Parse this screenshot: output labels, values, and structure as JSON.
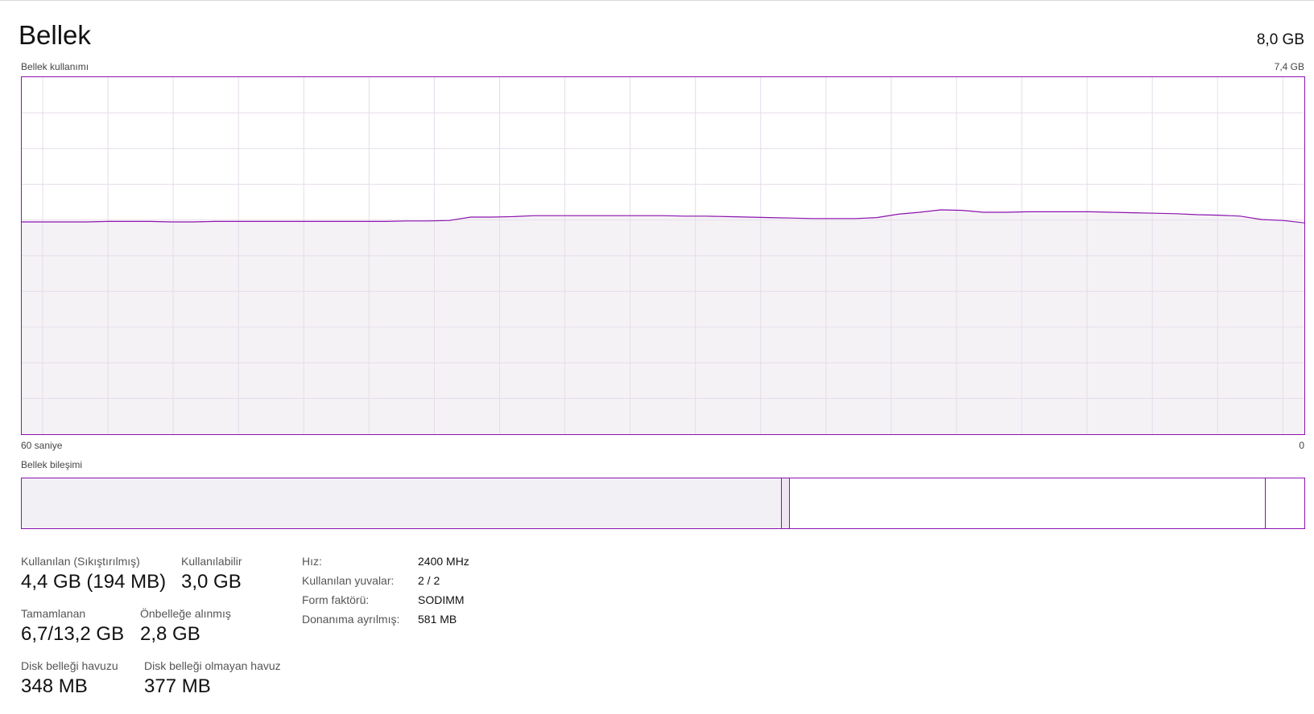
{
  "header": {
    "title": "Bellek",
    "capacity": "8,0 GB"
  },
  "graph": {
    "label": "Bellek kullanımı",
    "max_label": "7,4 GB",
    "time_left_label": "60 saniye",
    "time_right_label": "0",
    "line_color": "#8b12ae",
    "fill_color": "#f3f0f5",
    "grid_color": "#e6dcea",
    "chart_data": {
      "type": "area",
      "x_label": "60 saniye → 0",
      "ylim": [
        0,
        7.4
      ],
      "x": [
        60,
        59,
        58,
        57,
        56,
        55,
        54,
        53,
        52,
        51,
        50,
        49,
        48,
        47,
        46,
        45,
        44,
        43,
        42,
        41,
        40,
        39,
        38,
        37,
        36,
        35,
        34,
        33,
        32,
        31,
        30,
        29,
        28,
        27,
        26,
        25,
        24,
        23,
        22,
        21,
        20,
        19,
        18,
        17,
        16,
        15,
        14,
        13,
        12,
        11,
        10,
        9,
        8,
        7,
        6,
        5,
        4,
        3,
        2,
        1,
        0
      ],
      "values": [
        4.4,
        4.4,
        4.4,
        4.4,
        4.41,
        4.41,
        4.41,
        4.4,
        4.4,
        4.41,
        4.41,
        4.41,
        4.41,
        4.41,
        4.41,
        4.41,
        4.41,
        4.41,
        4.42,
        4.42,
        4.43,
        4.5,
        4.5,
        4.51,
        4.53,
        4.53,
        4.53,
        4.53,
        4.53,
        4.53,
        4.53,
        4.52,
        4.52,
        4.51,
        4.5,
        4.49,
        4.48,
        4.47,
        4.47,
        4.47,
        4.49,
        4.56,
        4.6,
        4.65,
        4.64,
        4.6,
        4.6,
        4.61,
        4.61,
        4.61,
        4.61,
        4.6,
        4.59,
        4.58,
        4.57,
        4.55,
        4.54,
        4.52,
        4.45,
        4.43,
        4.38
      ]
    },
    "vertical_gridlines": 20,
    "horizontal_gridlines": 10
  },
  "composition": {
    "label": "Bellek bileşimi",
    "segments": [
      {
        "name": "in-use",
        "fraction": 0.592,
        "color": "#f3f0f5"
      },
      {
        "name": "modified",
        "fraction": 0.006,
        "color": "#efe6f2"
      },
      {
        "name": "standby",
        "fraction": 0.371,
        "color": "#ffffff"
      },
      {
        "name": "free",
        "fraction": 0.031,
        "color": "#ffffff"
      }
    ]
  },
  "stats": {
    "in_use_label": "Kullanılan (Sıkıştırılmış)",
    "in_use_value": "4,4 GB (194 MB)",
    "available_label": "Kullanılabilir",
    "available_value": "3,0 GB",
    "committed_label": "Tamamlanan",
    "committed_value": "6,7/13,2 GB",
    "cached_label": "Önbelleğe alınmış",
    "cached_value": "2,8 GB",
    "paged_label": "Disk belleği havuzu",
    "paged_value": "348 MB",
    "nonpaged_label": "Disk belleği olmayan havuz",
    "nonpaged_value": "377 MB"
  },
  "info": {
    "speed_label": "Hız:",
    "speed_value": "2400 MHz",
    "slots_label": "Kullanılan yuvalar:",
    "slots_value": "2 / 2",
    "form_label": "Form faktörü:",
    "form_value": "SODIMM",
    "reserved_label": "Donanıma ayrılmış:",
    "reserved_value": "581 MB"
  }
}
